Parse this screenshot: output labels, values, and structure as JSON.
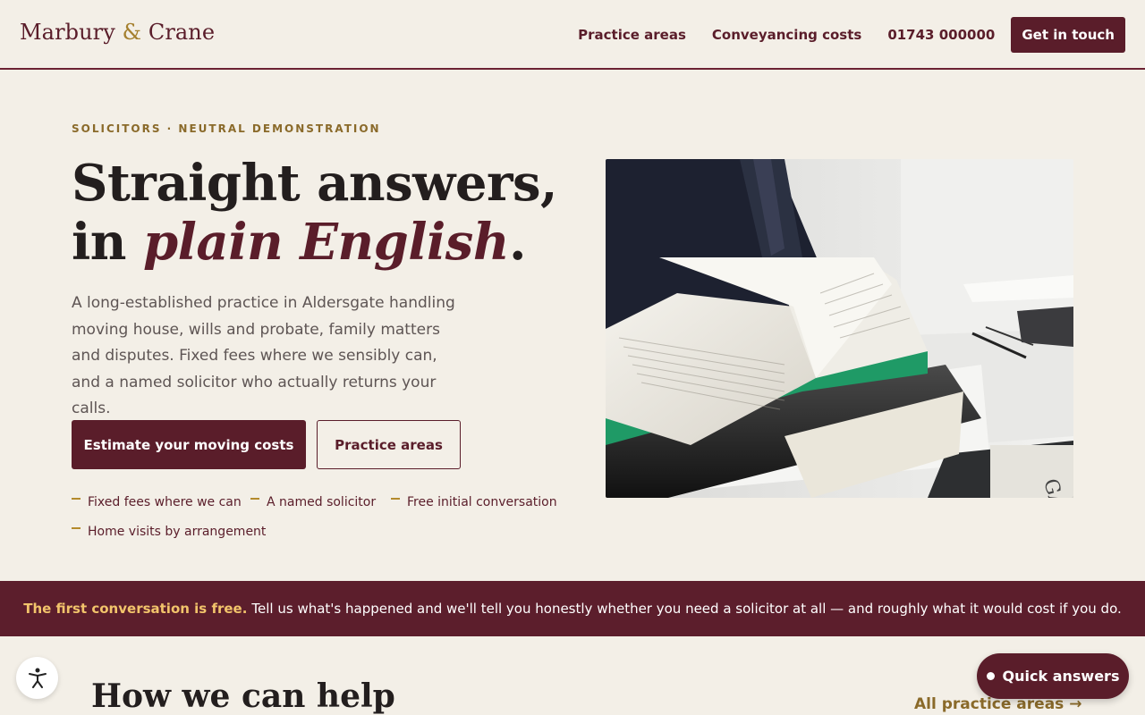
{
  "header": {
    "brand_part1": "Marbury",
    "brand_amp": "&",
    "brand_part2": "Crane",
    "nav": [
      {
        "label": "Practice areas"
      },
      {
        "label": "Conveyancing costs"
      },
      {
        "label": "01743 000000"
      }
    ],
    "cta_label": "Get in touch"
  },
  "hero": {
    "eyebrow": "SOLICITORS · NEUTRAL DEMONSTRATION",
    "headline_line1": "Straight answers,",
    "headline_in": "in",
    "headline_em": "plain English",
    "headline_end": ".",
    "lede": "A long-established practice in Aldersgate handling moving house, wills and probate, family matters and disputes. Fixed fees where we sensibly can, and a named solicitor who actually returns your calls.",
    "primary_button": "Estimate your moving costs",
    "secondary_button": "Practice areas",
    "features": [
      "Fixed fees where we can",
      "A named solicitor",
      "Free initial conversation",
      "Home visits by arrangement"
    ]
  },
  "banner": {
    "strong": "The first conversation is free.",
    "text": "Tell us what's happened and we'll tell you honestly whether you need a solicitor at all — and roughly what it would cost if you do."
  },
  "section": {
    "title": "How we can help",
    "link": "All practice areas →"
  },
  "widgets": {
    "accessibility_icon": "accessibility-person-icon",
    "quick_answers": "Quick answers"
  },
  "colors": {
    "brand": "#5a1d2a",
    "accent": "#a5802f",
    "banner_highlight": "#f2c46b",
    "background": "#f3efe7"
  }
}
